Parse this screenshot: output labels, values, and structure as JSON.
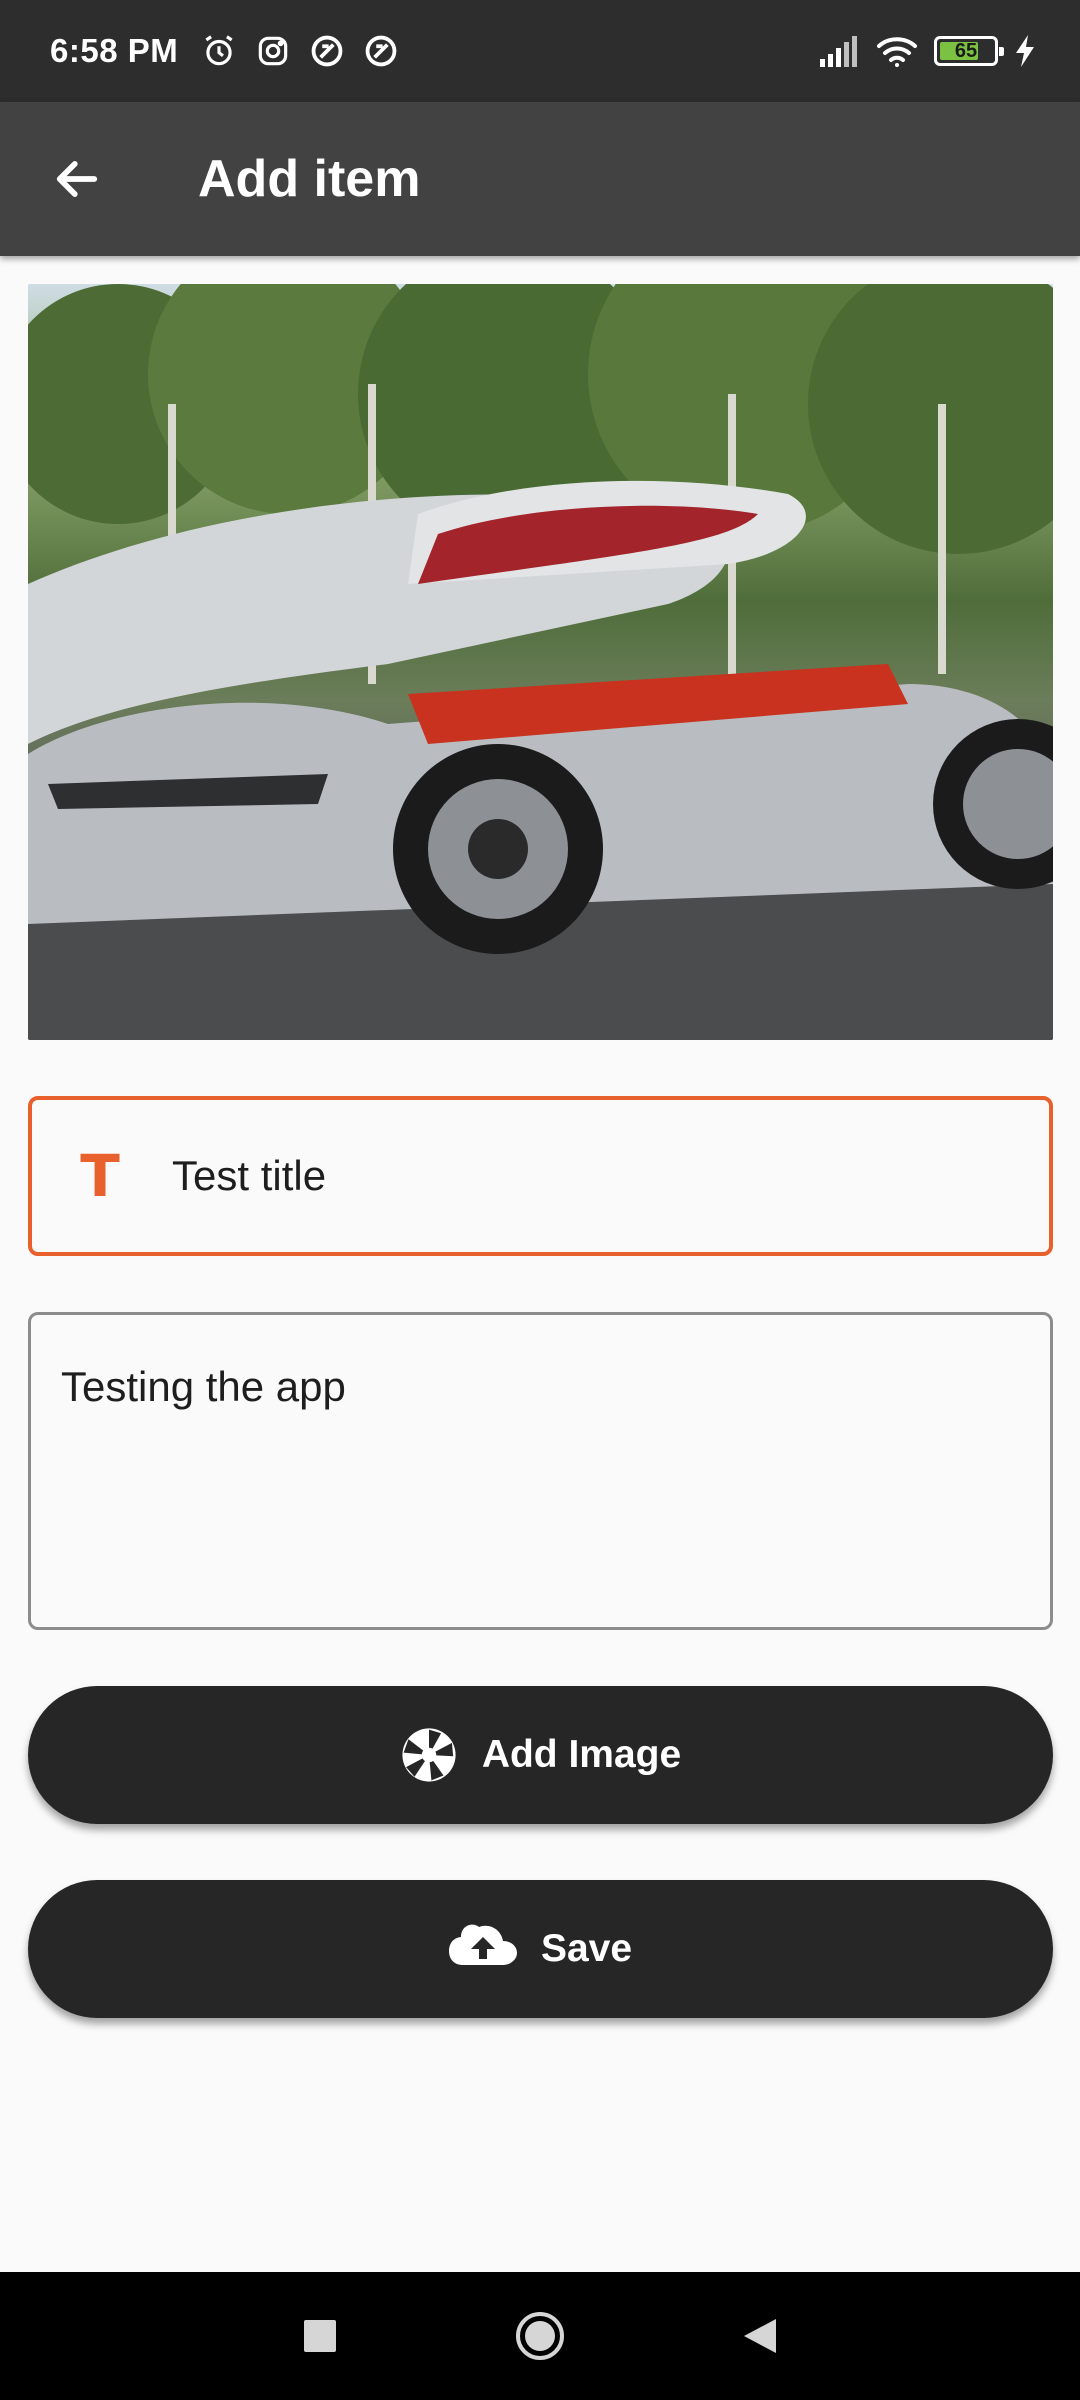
{
  "status_bar": {
    "time": "6:58 PM",
    "battery_level": "65",
    "icons": [
      "alarm-icon",
      "instagram-icon",
      "app-notification-icon",
      "app-notification-icon",
      "signal-icon",
      "wifi-icon",
      "battery-icon",
      "charging-icon"
    ]
  },
  "app_bar": {
    "title": "Add item",
    "back_icon": "arrow-left-icon"
  },
  "form": {
    "title_value": "Test title",
    "title_icon_glyph": "T",
    "description_value": "Testing the app"
  },
  "buttons": {
    "add_image_label": "Add Image",
    "save_label": "Save"
  },
  "colors": {
    "accent": "#e8602c",
    "app_bar": "#424242",
    "button": "#262626"
  }
}
